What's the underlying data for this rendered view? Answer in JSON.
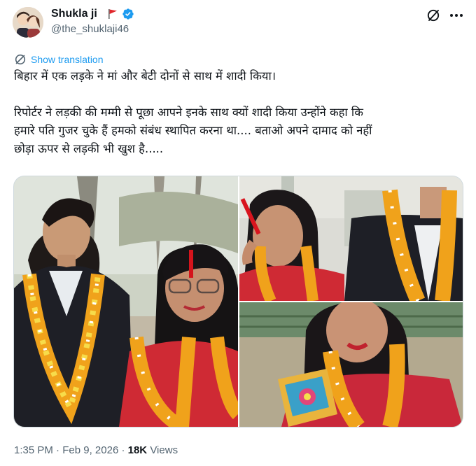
{
  "author": {
    "display_name": "Shukla ji",
    "handle": "@the_shuklaji46",
    "verified": true,
    "flag_icon": "red-flag-icon",
    "badge_color": "#1d9bf0"
  },
  "actions": {
    "grok_icon": "grok-icon",
    "more_icon": "more-icon"
  },
  "translation": {
    "label": "Show translation",
    "icon": "globe-icon"
  },
  "tweet": {
    "line1": "बिहार में एक लड़के ने मां और बेटी दोनों से साथ में शादी किया।",
    "paragraph2": " रिपोर्टर ने लड़की की मम्मी से पूछा आपने इनके साथ क्यों शादी किया उन्होंने कहा कि\nहमारे पति गुजर चुके हैं हमको संबंध स्थापित करना था.... बताओ अपने दामाद को नहीं\nछोड़ा ऊपर से लड़की भी खुश है....."
  },
  "media": {
    "photos": [
      "photo-1",
      "photo-2",
      "photo-3"
    ]
  },
  "meta": {
    "time": "1:35 PM",
    "separator": "·",
    "date": "Feb 9, 2026",
    "views_count": "18K",
    "views_label": "Views"
  },
  "colors": {
    "link": "#1d9bf0",
    "secondary_text": "#536471",
    "primary_text": "#0f1419"
  }
}
